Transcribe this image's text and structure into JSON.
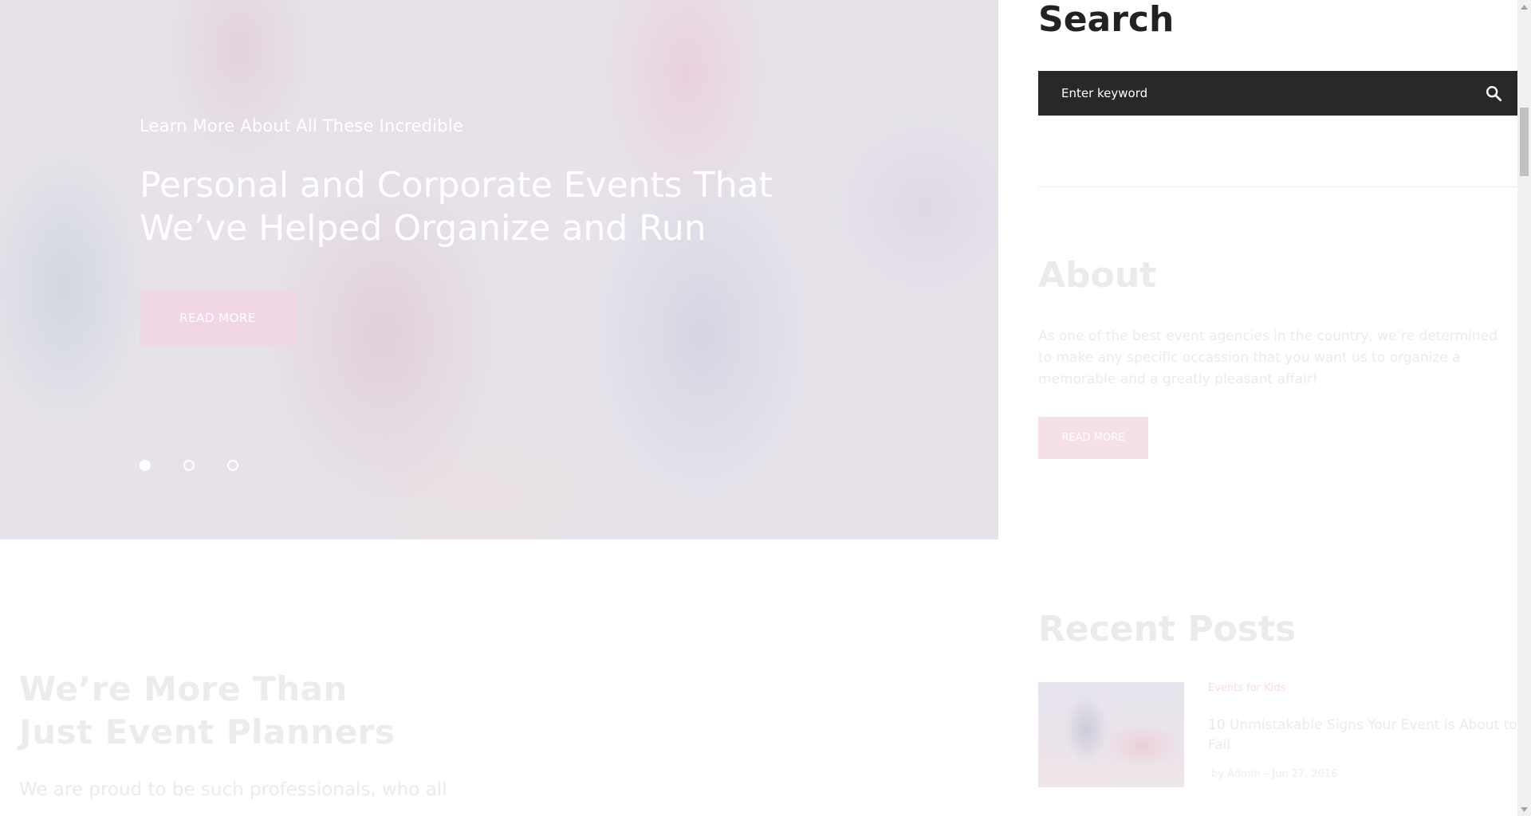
{
  "hero": {
    "kicker": "Learn More About All These Incredible",
    "title": "Personal and Corporate Events That We’ve Helped Organize and Run",
    "button_label": "READ MORE",
    "slides_count": 3,
    "active_slide": 1
  },
  "intro": {
    "title_line1": "We’re More Than",
    "title_line2": "Just Event Planners",
    "text": "We are proud to be such professionals, who all"
  },
  "sidebar": {
    "search": {
      "heading": "Search",
      "placeholder": "Enter keyword"
    },
    "about": {
      "heading": "About",
      "text": "As one of the best event agencies in the country, we’re determined to make any specific occassion that you want us to organize a memorable and a greatly pleasant affair!",
      "button_label": "READ MORE"
    },
    "recent_posts": {
      "heading": "Recent Posts",
      "items": [
        {
          "category": "Events for Kids",
          "title": "10 Unmistakable Signs Your Event is About to Fail",
          "meta": "by Admin – Jun 27, 2016"
        }
      ]
    }
  },
  "colors": {
    "search_bar": "#282828",
    "accent_pink": "#f1d6e3",
    "heading_dark": "#222222"
  }
}
